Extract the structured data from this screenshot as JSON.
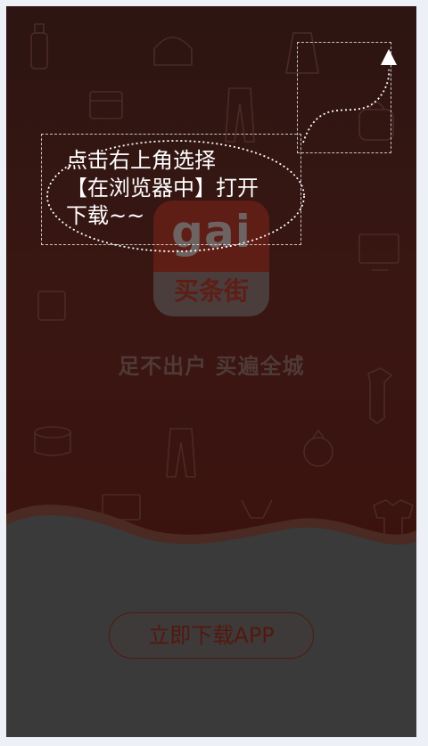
{
  "logo": {
    "word": "gai",
    "name": "买条街"
  },
  "tagline": "足不出户  买遍全城",
  "download_button": "立即下载APP",
  "overlay": {
    "tip_line1": "点击右上角选择",
    "tip_line2": "【在浏览器中】打开",
    "tip_line3": "下载~~"
  },
  "colors": {
    "hero": "#3a1612",
    "bottom": "#3a3a3a",
    "brand_red": "#53180f"
  },
  "icons": [
    "arrow-up-icon",
    "clothing-icons-background"
  ]
}
